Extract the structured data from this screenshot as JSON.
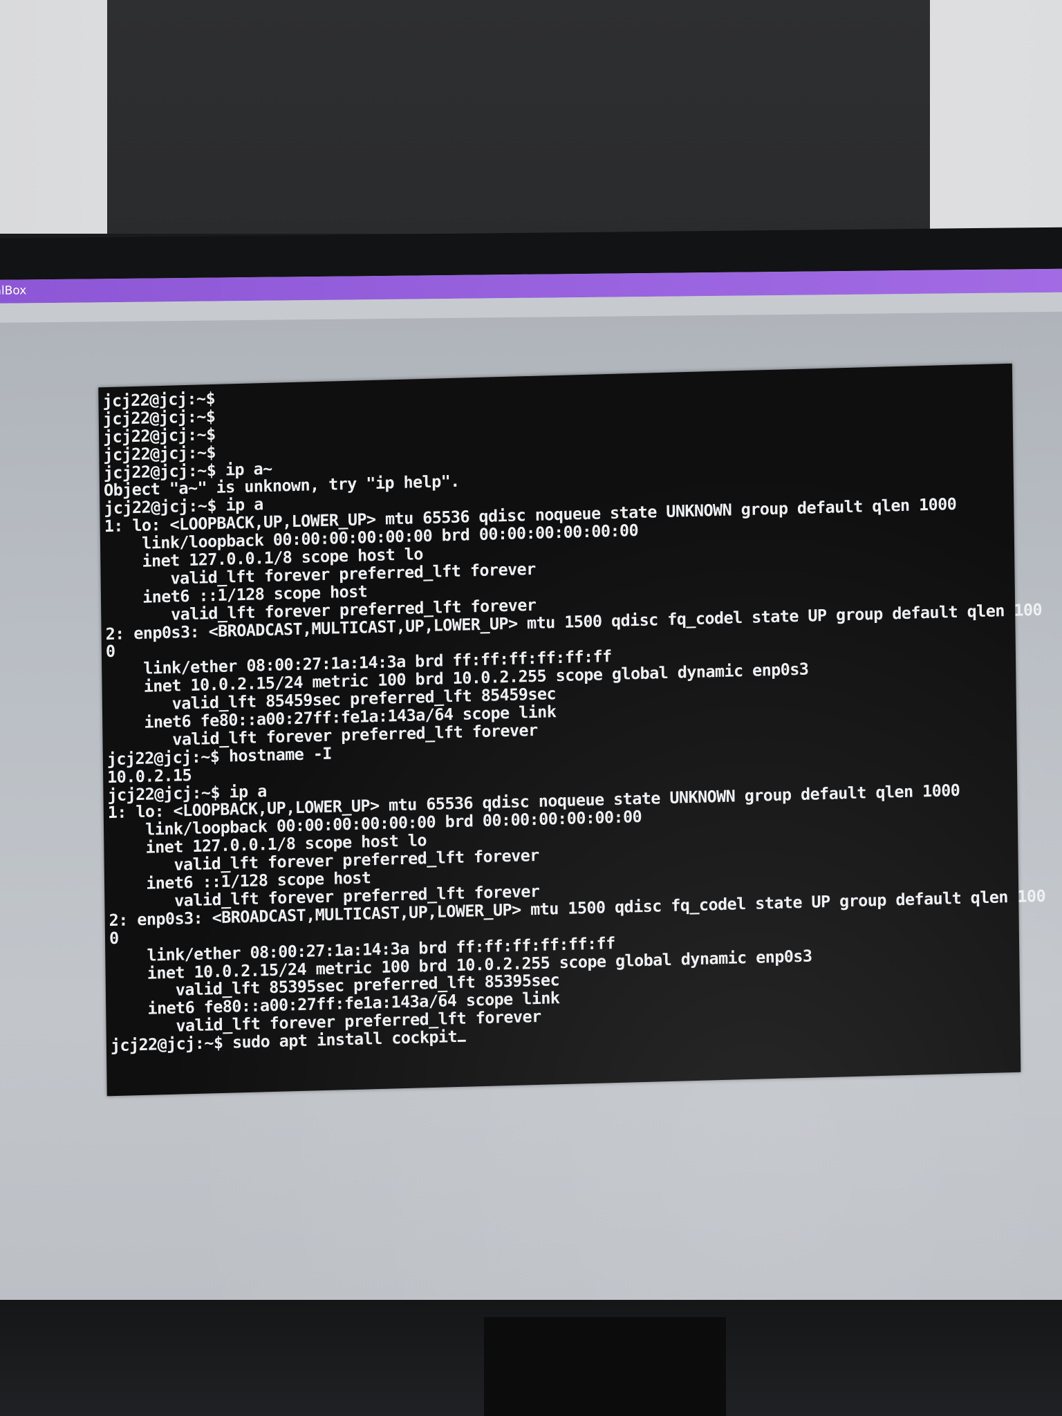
{
  "window": {
    "title_fragment": "ualBox"
  },
  "terminal": {
    "lines": [
      "jcj22@jcj:~$",
      "jcj22@jcj:~$",
      "jcj22@jcj:~$",
      "jcj22@jcj:~$",
      "jcj22@jcj:~$ ip a~",
      "Object \"a~\" is unknown, try \"ip help\".",
      "jcj22@jcj:~$ ip a",
      "1: lo: <LOOPBACK,UP,LOWER_UP> mtu 65536 qdisc noqueue state UNKNOWN group default qlen 1000",
      "    link/loopback 00:00:00:00:00:00 brd 00:00:00:00:00:00",
      "    inet 127.0.0.1/8 scope host lo",
      "       valid_lft forever preferred_lft forever",
      "    inet6 ::1/128 scope host",
      "       valid_lft forever preferred_lft forever",
      "2: enp0s3: <BROADCAST,MULTICAST,UP,LOWER_UP> mtu 1500 qdisc fq_codel state UP group default qlen 100",
      "0",
      "    link/ether 08:00:27:1a:14:3a brd ff:ff:ff:ff:ff:ff",
      "    inet 10.0.2.15/24 metric 100 brd 10.0.2.255 scope global dynamic enp0s3",
      "       valid_lft 85459sec preferred_lft 85459sec",
      "    inet6 fe80::a00:27ff:fe1a:143a/64 scope link",
      "       valid_lft forever preferred_lft forever",
      "jcj22@jcj:~$ hostname -I",
      "10.0.2.15",
      "jcj22@jcj:~$ ip a",
      "1: lo: <LOOPBACK,UP,LOWER_UP> mtu 65536 qdisc noqueue state UNKNOWN group default qlen 1000",
      "    link/loopback 00:00:00:00:00:00 brd 00:00:00:00:00:00",
      "    inet 127.0.0.1/8 scope host lo",
      "       valid_lft forever preferred_lft forever",
      "    inet6 ::1/128 scope host",
      "       valid_lft forever preferred_lft forever",
      "2: enp0s3: <BROADCAST,MULTICAST,UP,LOWER_UP> mtu 1500 qdisc fq_codel state UP group default qlen 100",
      "0",
      "    link/ether 08:00:27:1a:14:3a brd ff:ff:ff:ff:ff:ff",
      "    inet 10.0.2.15/24 metric 100 brd 10.0.2.255 scope global dynamic enp0s3",
      "       valid_lft 85395sec preferred_lft 85395sec",
      "    inet6 fe80::a00:27ff:fe1a:143a/64 scope link",
      "       valid_lft forever preferred_lft forever"
    ],
    "current_prompt": "jcj22@jcj:~$",
    "current_input": " sudo apt install cockpit"
  }
}
